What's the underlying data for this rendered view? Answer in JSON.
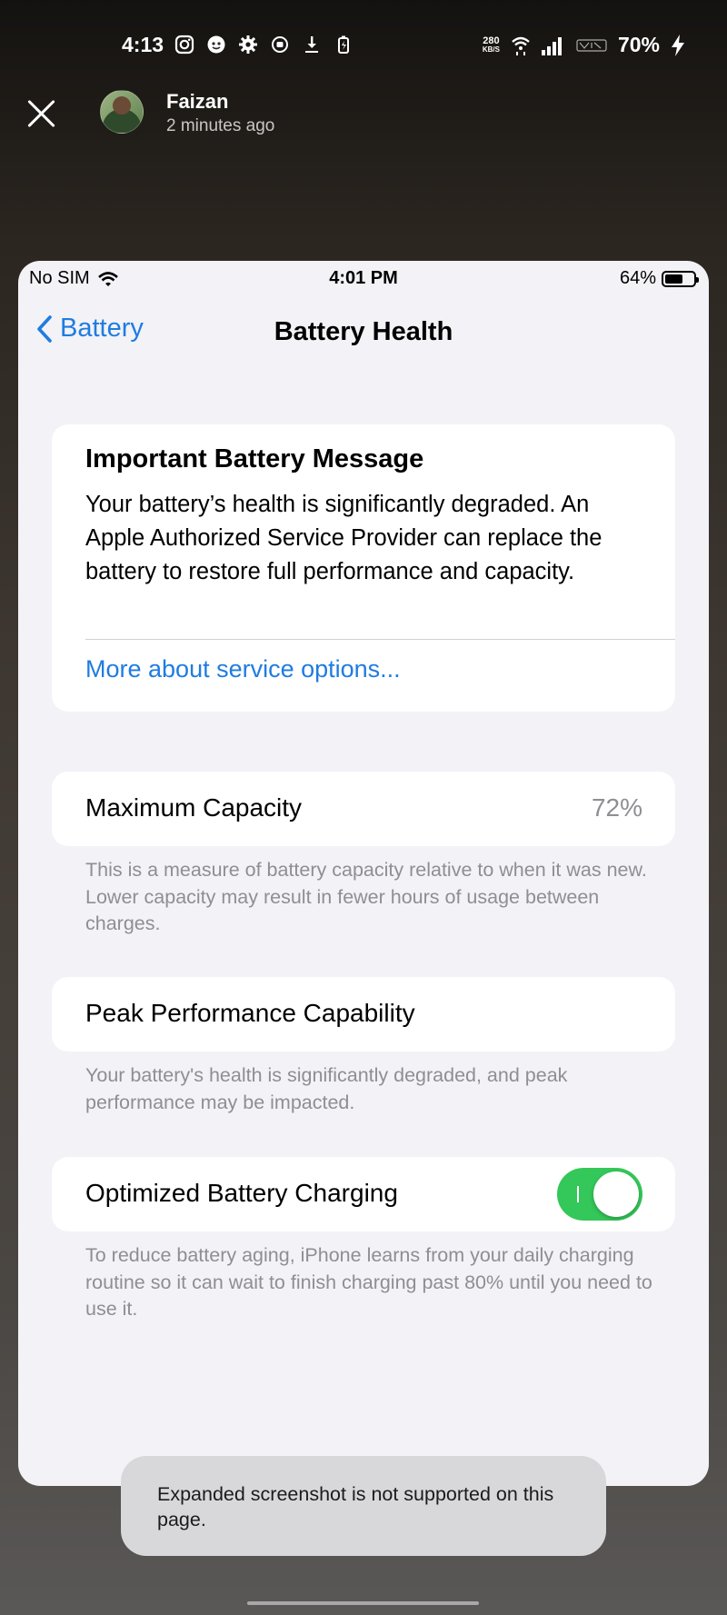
{
  "android_status": {
    "time": "4:13",
    "net_speed": "280",
    "net_speed_unit": "KB/S",
    "battery": "70%",
    "left_icons": [
      "instagram-icon",
      "face-app-icon",
      "gear-icon",
      "record-icon",
      "download-icon",
      "battery-saver-icon"
    ],
    "right_icons": [
      "wifi-icon",
      "signal-icon",
      "volte-icon",
      "charging-icon"
    ]
  },
  "story": {
    "poster_name": "Faizan",
    "posted_time": "2 minutes ago"
  },
  "ios_status": {
    "carrier": "No SIM",
    "time": "4:01 PM",
    "battery": "64%",
    "battery_level": 0.64
  },
  "nav": {
    "back_label": "Battery",
    "title": "Battery Health"
  },
  "message": {
    "title": "Important Battery Message",
    "body": "Your battery’s health is significantly degraded. An Apple Authorized Service Provider can replace the battery to restore full performance and capacity.",
    "link": "More about service options..."
  },
  "max_capacity": {
    "label": "Maximum Capacity",
    "value": "72%",
    "footnote": "This is a measure of battery capacity relative to when it was new. Lower capacity may result in fewer hours of usage between charges."
  },
  "peak_performance": {
    "label": "Peak Performance Capability",
    "footnote": "Your battery's health is significantly degraded, and peak performance may be impacted."
  },
  "optimized_charging": {
    "label": "Optimized Battery Charging",
    "enabled": true,
    "toggle_color": "#34c759",
    "footnote": "To reduce battery aging, iPhone learns from your daily charging routine so it can wait to finish charging past 80% until you need to use it."
  },
  "toast": {
    "text": "Expanded screenshot is not supported on this page."
  },
  "colors": {
    "ios_blue": "#1f7ce0",
    "ios_background": "#f2f2f7",
    "secondary_text": "#8e8e93"
  }
}
